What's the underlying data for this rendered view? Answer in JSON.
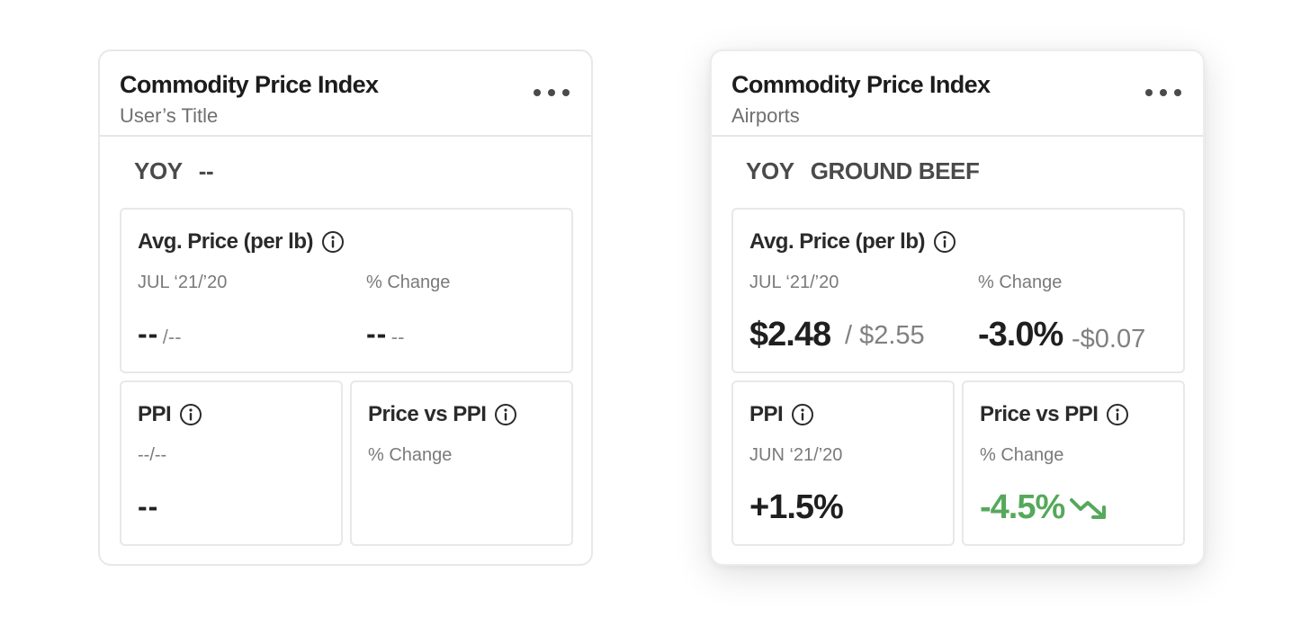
{
  "cards": {
    "left": {
      "title": "Commodity Price Index",
      "subtitle": "User’s Title",
      "yoy_label": "YOY",
      "product": "--",
      "avg_price": {
        "title": "Avg. Price (per lb)",
        "period_label": "JUL ‘21/’20",
        "change_label": "% Change",
        "current": "--",
        "previous": "/--",
        "change_value": "--",
        "change_amount": "--"
      },
      "ppi": {
        "title": "PPI",
        "period_label": "--/--",
        "value": "--"
      },
      "price_vs_ppi": {
        "title": "Price vs PPI",
        "change_label": "% Change"
      }
    },
    "right": {
      "title": "Commodity Price Index",
      "subtitle": "Airports",
      "yoy_label": "YOY",
      "product": "GROUND BEEF",
      "avg_price": {
        "title": "Avg. Price (per lb)",
        "period_label": "JUL ‘21/’20",
        "change_label": "% Change",
        "current": "$2.48",
        "previous": "/ $2.55",
        "change_value": "-3.0%",
        "change_amount": "-$0.07"
      },
      "ppi": {
        "title": "PPI",
        "period_label": "JUN ‘21/’20",
        "value": "+1.5%"
      },
      "price_vs_ppi": {
        "title": "Price vs PPI",
        "change_label": "% Change",
        "value": "-4.5%"
      }
    }
  },
  "icons": {
    "menu": "more-horizontal-icon",
    "info": "info-circle-icon",
    "trend": "trending-down-icon"
  },
  "colors": {
    "positive_trend": "#56a85b",
    "text_primary": "#1f1f1f",
    "text_secondary": "#7a7a7a",
    "border": "#e8e8e8"
  }
}
